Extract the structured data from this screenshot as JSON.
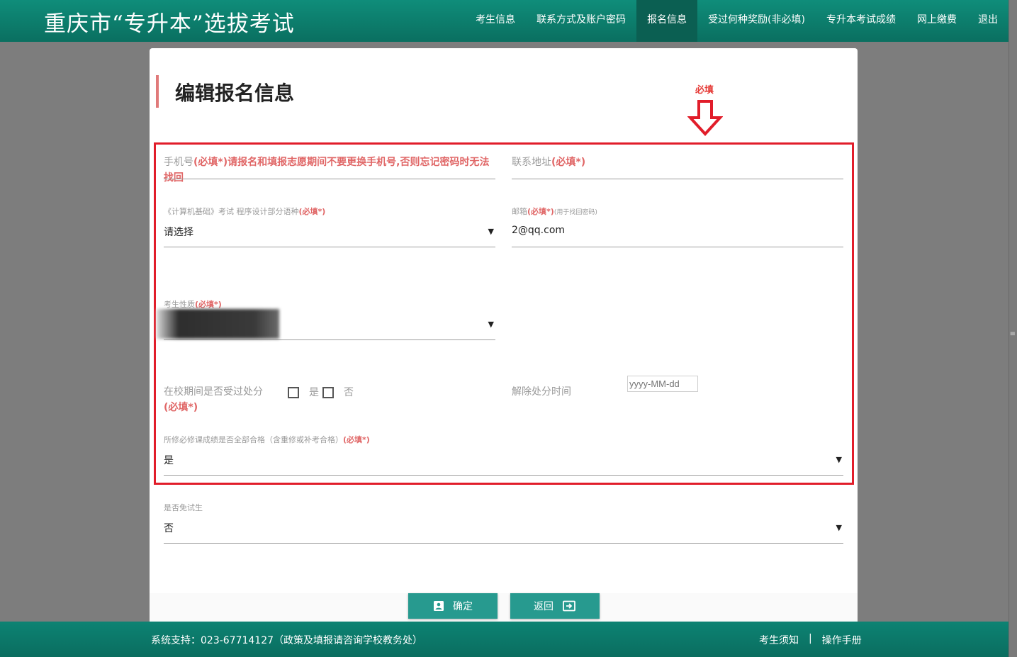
{
  "header": {
    "site_title": "重庆市“专升本”选拔考试",
    "nav": [
      {
        "label": "考生信息"
      },
      {
        "label": "联系方式及账户密码"
      },
      {
        "label": "报名信息"
      },
      {
        "label": "受过何种奖励(非必填)"
      },
      {
        "label": "专升本考试成绩"
      },
      {
        "label": "网上缴费"
      },
      {
        "label": "退出"
      }
    ]
  },
  "page": {
    "title": "编辑报名信息",
    "hint_label": "必填",
    "required_mark": "(必填*)"
  },
  "form": {
    "phone": {
      "label": "手机号",
      "note": "请报名和填报志愿期间不要更换手机号,否则忘记密码时无法找回"
    },
    "address": {
      "label": "联系地址"
    },
    "language": {
      "label": "《计算机基础》考试 程序设计部分语种",
      "value": "请选择"
    },
    "email": {
      "label": "邮箱",
      "sub_note": "(用于找回密码)",
      "value": "2@qq.com"
    },
    "nature": {
      "label": "考生性质"
    },
    "discipline": {
      "label": "在校期间是否受过处分",
      "options": [
        "是",
        "否"
      ]
    },
    "release_time": {
      "label": "解除处分时间",
      "placeholder": "yyyy-MM-dd"
    },
    "courses": {
      "label": "所修必修课成绩是否全部合格（含重修或补考合格）",
      "value": "是"
    },
    "exempt": {
      "label": "是否免试生",
      "value": "否"
    }
  },
  "buttons": {
    "confirm": "确定",
    "back": "返回"
  },
  "footer": {
    "support": "系统支持：023-67714127（政策及填报请咨询学校教务处）",
    "links": [
      "考生须知",
      "操作手册"
    ],
    "separator": "|"
  },
  "colors": {
    "brand": "#0f8d7a",
    "required": "#e06666",
    "frame": "#e11d2a"
  }
}
